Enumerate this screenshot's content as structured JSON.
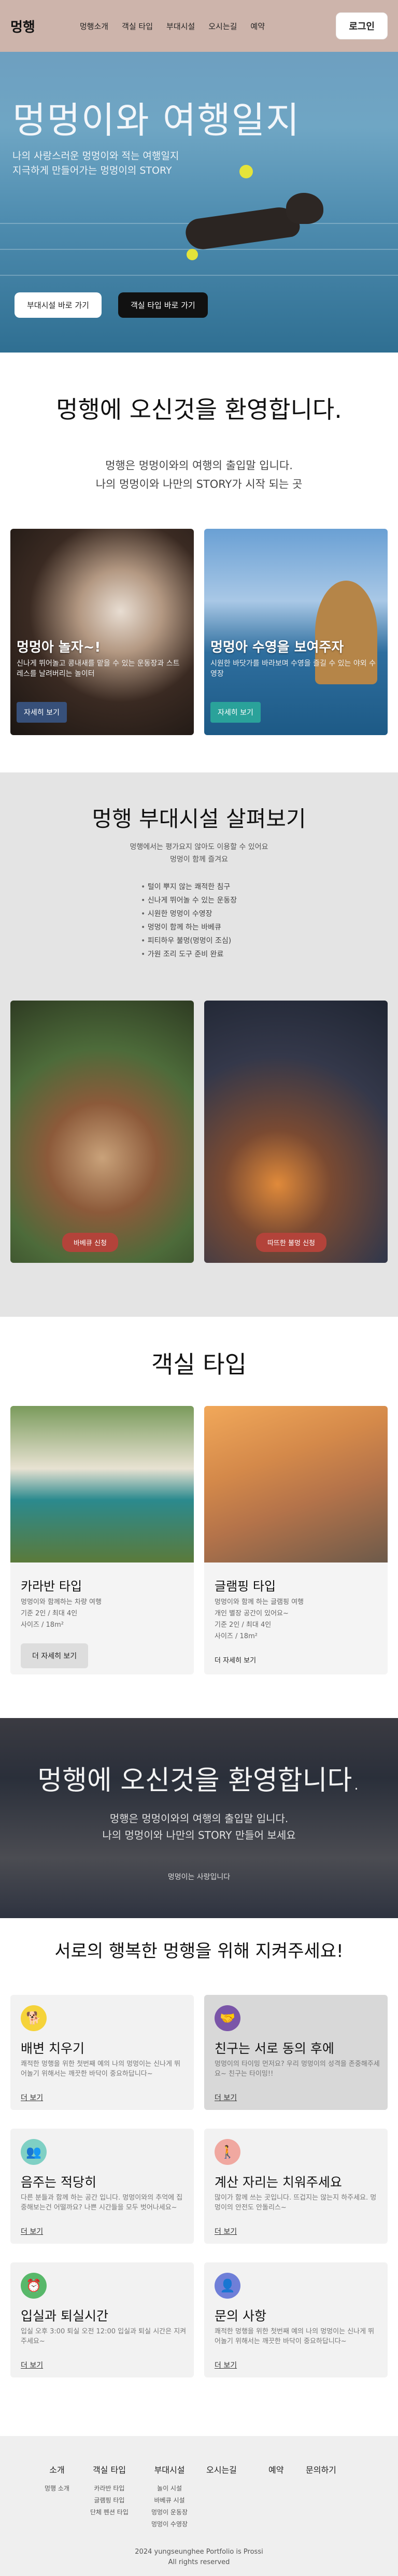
{
  "header": {
    "logo": "멍행",
    "nav": [
      "멍행소개",
      "객실 타입",
      "부대시설",
      "오시는길",
      "예약"
    ],
    "login": "로그인"
  },
  "hero": {
    "title": "멍멍이와 여행일지",
    "line1": "나의 사랑스러운 멍멍이와 적는 여행일지",
    "line2": "지극하게 만들어가는 멍멍이의 STORY",
    "btn_facility": "부대시설 바로 가기",
    "btn_room": "객실 타입 바로 가기"
  },
  "welcome": {
    "title": "멍행에 오신것을 환영합니다.",
    "line1": "멍행은 멍멍이와의 여행의 출입말 입니다.",
    "line2": "나의 멍멍이와 나만의 STORY가 시작 되는 곳"
  },
  "cards": [
    {
      "title": "멍멍아 놀자~!",
      "desc": "신나게 뛰어놀고 콩내새를 맡을 수 있는 운동장과 스트레스를 날려버리는 놀이터",
      "btn": "자세히 보기"
    },
    {
      "title": "멍멍아 수영을 보여주자",
      "desc": "시원한 바닷가를 바라보며 수영을 즐길 수 있는 야외 수영장",
      "btn": "자세히 보기"
    }
  ],
  "facilities": {
    "title": "멍행 부대시설 살펴보기",
    "sub1": "멍행에서는 평가요지 않아도 이용할 수 있어요",
    "sub2": "멍멍이 함께 즐겨요",
    "items": [
      "털이 뿌지 않는 쾌적한 침구",
      "신나게 뛰어놀 수 있는 운동장",
      "시원한 멍멍이 수영장",
      "멍멍이 함께 하는 바베큐",
      "피티하우 불멍(멍멍이 조심)",
      "가원 조리 도구 준비 완료"
    ],
    "btn_bbq": "바베큐 신청",
    "btn_fire": "따뜨한 불멍 신청"
  },
  "rooms": {
    "title": "객실 타입",
    "items": [
      {
        "name": "카라반 타입",
        "desc": [
          "멍멍이와 함께하는 차량 여행",
          "기준 2인 / 최대 4인",
          "사이즈 / 18m²"
        ],
        "btn": "더 자세히 보기"
      },
      {
        "name": "글램핑 타입",
        "desc": [
          "멍멍이와 함께 하는 글램핑 여행",
          "개인 별장 공간이 있어요~",
          "기준 2인 / 최대 4인",
          "사이즈 / 18m²"
        ],
        "btn": "더 자세히 보기"
      }
    ]
  },
  "banner": {
    "title": "멍행에 오신것을 환영합니다.",
    "line1": "멍행은 멍멍이와의 여행의 출입말 입니다.",
    "line2": "나의 멍멍이와 나만의 STORY 만들어 보세요",
    "small": "멍멍이는 사랑입니다"
  },
  "etiquette": {
    "title": "서로의 행복한 멍행을 위해 지켜주세요!",
    "more": "더 보기",
    "items": [
      {
        "title": "배변 치우기",
        "desc": "쾌적한 멍행을 위한 첫번째 예의 나의 멍멍이는 신나게 뛰어놀기 위해서는 깨끗한 바닥이 중요하답니다~",
        "color": "#f5d33a",
        "icon": "dog-icon"
      },
      {
        "title": "친구는 서로 동의 후에",
        "desc": "멍멍이의 타이밍 먼저요? 우리 멍멍이의 성격을 존중해주세요~ 친구는 타이밍!!",
        "color": "#7a55a8",
        "icon": "handshake-icon"
      },
      {
        "title": "음주는 적당히",
        "desc": "다른 분들과 함께 하는 공간 입니다. 멍멍이와의 추억에 집중해보는건 어떨까요? 나쁜 시간들을 모두 벗어나세요~",
        "color": "#7fd0c4",
        "icon": "people-icon"
      },
      {
        "title": "계산 자리는 치워주세요",
        "desc": "많이가 함께 쓰는 곳입니다. 뜨겁지는 않는지 하주세요. 멍멍이의 안전도 안돌리스~",
        "color": "#f0a8a0",
        "icon": "walk-icon"
      },
      {
        "title": "입실과 퇴실시간",
        "desc": "입실 오후 3:00 퇴실 오전 12:00 입실과 퇴실 시간은 지켜주세요~",
        "color": "#58b86a",
        "icon": "clock-icon"
      },
      {
        "title": "문의 사항",
        "desc": "쾌적한 멍행을 위한 첫번째 예의 나의 멍멍이는 신나게 뛰어놀기 위해서는 깨끗한 바닥이 중요하답니다~",
        "color": "#6f7fd8",
        "icon": "person-icon"
      }
    ]
  },
  "footer": {
    "cols": [
      {
        "h": "소개",
        "s": [
          "멍행 소개"
        ]
      },
      {
        "h": "객실 타입",
        "s": [
          "카라반 타입",
          "글램핑 타입",
          "단체 펜션 타입"
        ]
      },
      {
        "h": "부대시설",
        "s": [
          "놀이 시설",
          "바베큐 시설",
          "멍멍이 운동장",
          "멍멍이 수영장"
        ]
      },
      {
        "h": "오시는길",
        "s": []
      },
      {
        "h": "예약",
        "s": []
      },
      {
        "h": "문의하기",
        "s": []
      }
    ],
    "copy1": "2024 yungseunghee Portfolio is Prossi",
    "copy2": "All rights reserved"
  }
}
